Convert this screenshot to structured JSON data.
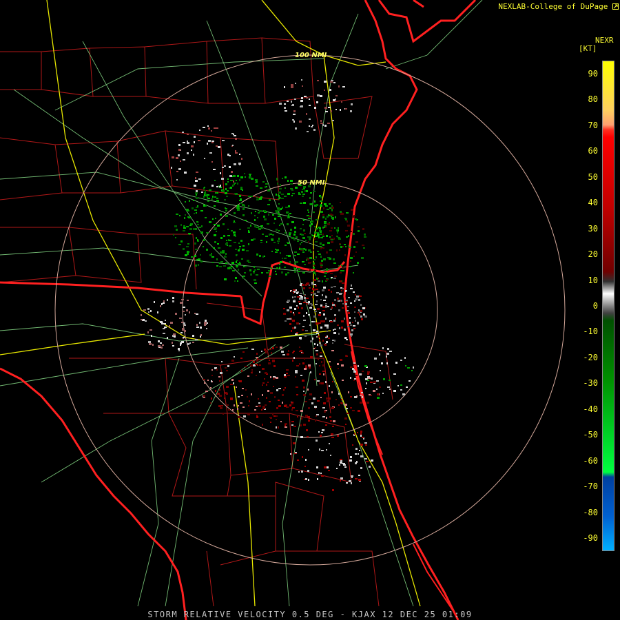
{
  "header": {
    "credit": "NEXLAB-College of DuPage",
    "credit_icon": "external-link-icon"
  },
  "caption": "STORM RELATIVE VELOCITY 0.5 DEG - KJAX 12 DEC 25 01:09",
  "rings": [
    {
      "label": "50 NMI",
      "range_nmi": 50
    },
    {
      "label": "100 NMI",
      "range_nmi": 100
    }
  ],
  "legend": {
    "title": "NEXR",
    "unit": "[KT]",
    "ticks": [
      "90",
      "80",
      "70",
      "60",
      "50",
      "40",
      "30",
      "20",
      "10",
      "0",
      "-10",
      "-20",
      "-30",
      "-40",
      "-50",
      "-60",
      "-70",
      "-80",
      "-90"
    ],
    "range": [
      -95,
      95
    ]
  },
  "colors": {
    "background": "#000000",
    "state_border": "#ff2020",
    "county_border": "#b01818",
    "highway": "#e8e800",
    "road": "#80d080",
    "range_ring": "#d4a89a",
    "text": "#ffff33"
  }
}
